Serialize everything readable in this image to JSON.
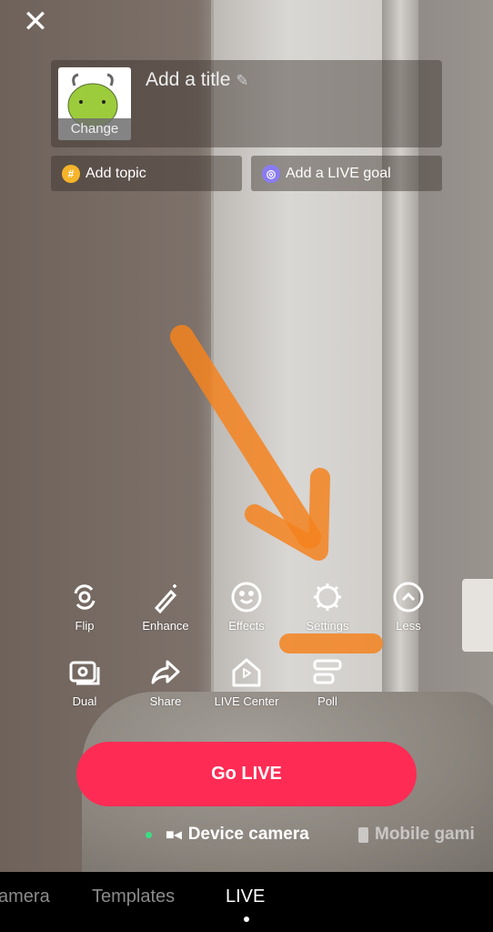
{
  "header": {
    "close_icon": "close-icon",
    "title_placeholder": "Add a title",
    "cover_label": "Change"
  },
  "pills": {
    "topic": "Add topic",
    "goal": "Add a LIVE goal"
  },
  "tools": [
    {
      "label": "Flip",
      "icon": "flip-camera-icon"
    },
    {
      "label": "Enhance",
      "icon": "magic-wand-icon"
    },
    {
      "label": "Effects",
      "icon": "smiley-icon"
    },
    {
      "label": "Settings",
      "icon": "gear-icon"
    },
    {
      "label": "Less",
      "icon": "chevron-up-icon"
    },
    {
      "label": "Dual",
      "icon": "dual-camera-icon"
    },
    {
      "label": "Share",
      "icon": "share-arrow-icon"
    },
    {
      "label": "LIVE Center",
      "icon": "live-center-house-icon"
    },
    {
      "label": "Poll",
      "icon": "poll-icon"
    }
  ],
  "go_live": "Go LIVE",
  "sources": {
    "device": "Device camera",
    "mobile": "Mobile gami"
  },
  "nav": {
    "camera": "amera",
    "templates": "Templates",
    "live": "LIVE"
  },
  "colors": {
    "accent": "#fe2c55",
    "annotation": "#f5821f",
    "active_dot": "#3ddc84"
  }
}
